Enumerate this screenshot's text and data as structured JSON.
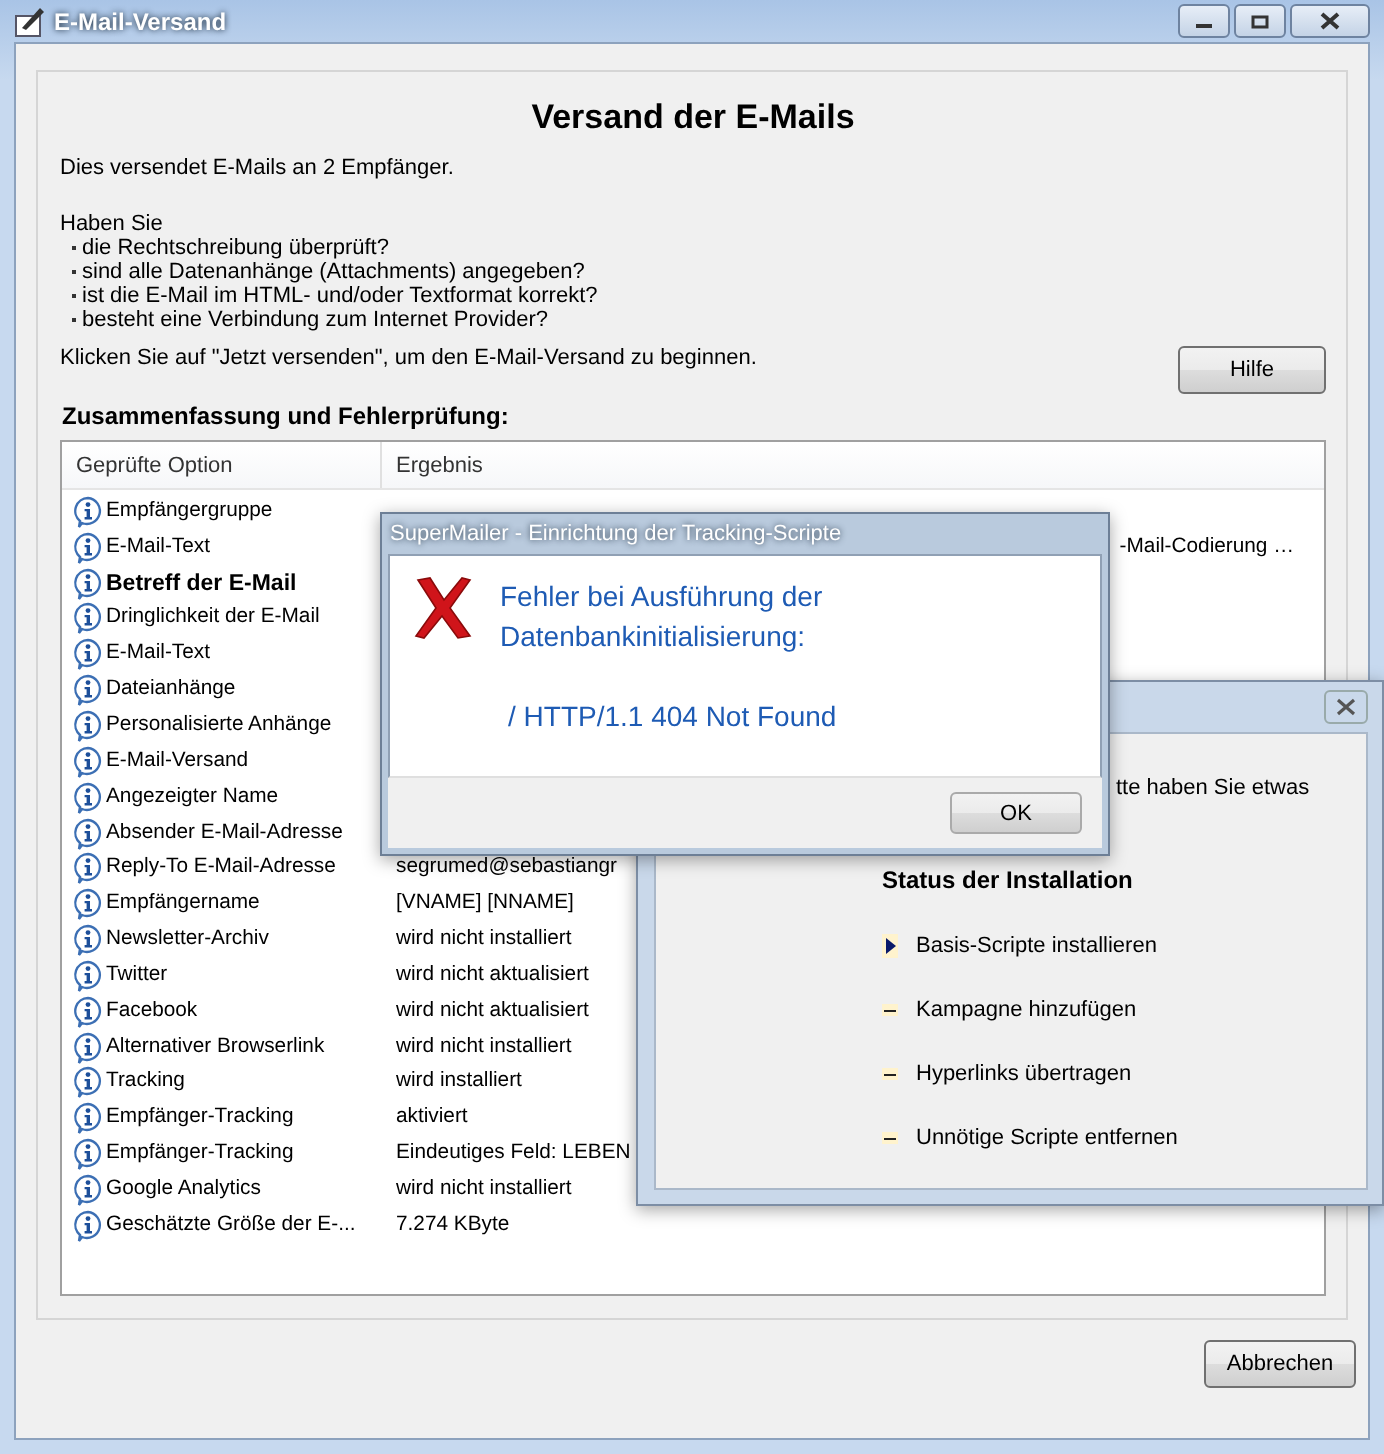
{
  "window": {
    "title": "E-Mail-Versand"
  },
  "heading": "Versand der E-Mails",
  "intro": "Dies versendet E-Mails an 2 Empfänger.",
  "question_header": "Haben Sie",
  "questions": [
    "die Rechtschreibung überprüft?",
    "sind alle Datenanhänge (Attachments) angegeben?",
    "ist die E-Mail im HTML- und/oder Textformat korrekt?",
    "besteht eine Verbindung zum Internet Provider?"
  ],
  "instruction": "Klicken Sie auf \"Jetzt versenden\", um den E-Mail-Versand zu beginnen.",
  "help_button": "Hilfe",
  "summary_title": "Zusammenfassung und Fehlerprüfung:",
  "columns": [
    "Geprüfte Option",
    "Ergebnis"
  ],
  "rows": [
    {
      "option": "Empfängergruppe",
      "bold": false
    },
    {
      "option": "E-Mail-Text",
      "bold": false,
      "result": "-Mail-Codierung …",
      "result_partly_covered": true
    },
    {
      "option": "Betreff der E-Mail",
      "bold": true
    },
    {
      "option": "Dringlichkeit der E-Mail",
      "bold": false
    },
    {
      "option": "E-Mail-Text",
      "bold": false
    },
    {
      "option": "Dateianhänge",
      "bold": false
    },
    {
      "option": "Personalisierte Anhänge",
      "bold": false
    },
    {
      "option": "E-Mail-Versand",
      "bold": false
    },
    {
      "option": "Angezeigter Name",
      "bold": false
    },
    {
      "option": "Absender E-Mail-Adresse",
      "bold": false
    },
    {
      "option": "Reply-To E-Mail-Adresse",
      "bold": false,
      "result": "segrumed@sebastiangr",
      "result_partly_covered": false
    },
    {
      "option": "Empfängername",
      "bold": false,
      "result": "[VNAME] [NNAME]",
      "result_partly_covered": false
    },
    {
      "option": "Newsletter-Archiv",
      "bold": false,
      "result": "wird nicht installiert",
      "result_partly_covered": false
    },
    {
      "option": "Twitter",
      "bold": false,
      "result": "wird nicht aktualisiert",
      "result_partly_covered": false
    },
    {
      "option": "Facebook",
      "bold": false,
      "result": "wird nicht aktualisiert",
      "result_partly_covered": false
    },
    {
      "option": "Alternativer Browserlink",
      "bold": false,
      "result": "wird nicht installiert",
      "result_partly_covered": false
    },
    {
      "option": "Tracking",
      "bold": false,
      "result": "wird installiert",
      "result_partly_covered": false
    },
    {
      "option": "Empfänger-Tracking",
      "bold": false,
      "result": "aktiviert",
      "result_partly_covered": false
    },
    {
      "option": "Empfänger-Tracking",
      "bold": false,
      "result": "Eindeutiges Feld: LEBEN",
      "result_partly_covered": false
    },
    {
      "option": "Google Analytics",
      "bold": false,
      "result": "wird nicht installiert",
      "result_partly_covered": false
    },
    {
      "option": "Geschätzte Größe der E-...",
      "bold": false,
      "result": "7.274 KByte",
      "result_partly_covered": false
    }
  ],
  "cancel_button": "Abbrechen",
  "install_dialog": {
    "text_fragment": "tte haben Sie etwas",
    "status_title": "Status der Installation",
    "steps": [
      {
        "label": "Basis-Scripte installieren",
        "current": true
      },
      {
        "label": "Kampagne hinzufügen",
        "current": false
      },
      {
        "label": "Hyperlinks übertragen",
        "current": false
      },
      {
        "label": "Unnötige Scripte entfernen",
        "current": false
      }
    ]
  },
  "error_dialog": {
    "title": "SuperMailer - Einrichtung der Tracking-Scripte",
    "message": [
      "Fehler bei Ausführung der",
      "Datenbankinitialisierung:"
    ],
    "detail": "/ HTTP/1.1 404 Not Found",
    "ok_button": "OK"
  }
}
